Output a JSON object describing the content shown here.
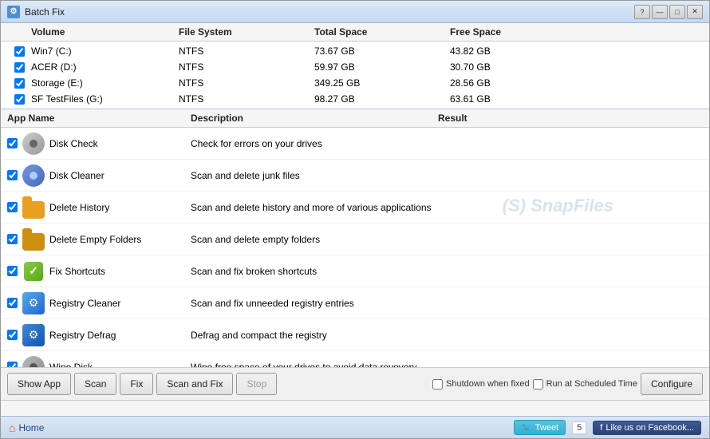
{
  "window": {
    "title": "Batch Fix",
    "controls": {
      "help": "?",
      "minimize": "—",
      "maximize": "□",
      "close": "✕"
    }
  },
  "drives": {
    "columns": [
      "",
      "Volume",
      "File System",
      "Total Space",
      "Free Space",
      ""
    ],
    "rows": [
      {
        "checked": true,
        "volume": "Win7 (C:)",
        "fs": "NTFS",
        "total": "73.67 GB",
        "free": "43.82 GB"
      },
      {
        "checked": true,
        "volume": "ACER (D:)",
        "fs": "NTFS",
        "total": "59.97 GB",
        "free": "30.70 GB"
      },
      {
        "checked": true,
        "volume": "Storage (E:)",
        "fs": "NTFS",
        "total": "349.25 GB",
        "free": "28.56 GB"
      },
      {
        "checked": true,
        "volume": "SF TestFiles (G:)",
        "fs": "NTFS",
        "total": "98.27 GB",
        "free": "63.61 GB"
      }
    ]
  },
  "apps": {
    "columns": [
      "App Name",
      "Description",
      "Result"
    ],
    "rows": [
      {
        "checked": true,
        "name": "Disk Check",
        "icon": "disk-check",
        "description": "Check for errors on your drives",
        "result": ""
      },
      {
        "checked": true,
        "name": "Disk Cleaner",
        "icon": "disk-cleaner",
        "description": "Scan and delete junk files",
        "result": ""
      },
      {
        "checked": true,
        "name": "Delete History",
        "icon": "delete-history",
        "description": "Scan and delete history and more of various applications",
        "result": ""
      },
      {
        "checked": true,
        "name": "Delete Empty Folders",
        "icon": "delete-empty-folders",
        "description": "Scan and delete empty folders",
        "result": ""
      },
      {
        "checked": true,
        "name": "Fix Shortcuts",
        "icon": "fix-shortcuts",
        "description": "Scan and fix broken shortcuts",
        "result": ""
      },
      {
        "checked": true,
        "name": "Registry Cleaner",
        "icon": "registry-cleaner",
        "description": "Scan and fix unneeded registry entries",
        "result": ""
      },
      {
        "checked": true,
        "name": "Registry Defrag",
        "icon": "registry-defrag",
        "description": "Defrag and compact the registry",
        "result": ""
      },
      {
        "checked": true,
        "name": "Wipe Disk",
        "icon": "wipe-disk",
        "description": "Wipe free space of your drives to avoid data revovery",
        "result": ""
      }
    ]
  },
  "toolbar": {
    "show_app": "Show App",
    "scan": "Scan",
    "fix": "Fix",
    "scan_and_fix": "Scan and Fix",
    "stop": "Stop",
    "shutdown_when_fixed": "Shutdown when fixed",
    "run_at_scheduled_time": "Run at Scheduled Time",
    "configure": "Configure"
  },
  "watermark": "(S) SnapFiles",
  "footer": {
    "home": "Home",
    "tweet": "Tweet",
    "tweet_count": "5",
    "facebook": "Like us on Facebook..."
  }
}
